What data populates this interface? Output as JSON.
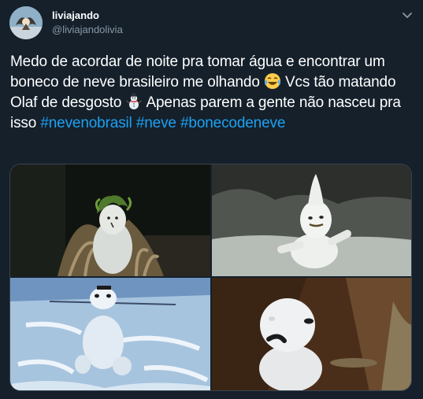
{
  "author": {
    "display_name": "liviajando",
    "handle": "@liviajandolivia"
  },
  "tweet": {
    "text_part1": "Medo de acordar de noite pra tomar água e encontrar um boneco de neve brasileiro me olhando ",
    "emoji1": "face-with-tears-of-joy-icon",
    "text_part2": " Vcs tão matando Olaf de desgosto ",
    "emoji2": "snowman-icon",
    "text_part3": " Apenas parem a gente não nasceu pra isso ",
    "hashtags": [
      "#nevenobrasil",
      "#neve",
      "#bonecodeneve"
    ]
  },
  "colors": {
    "background": "#15202b",
    "hashtag": "#1da1f2",
    "secondary_text": "#8899a6",
    "border": "#38444d"
  },
  "media": {
    "count": 4
  }
}
